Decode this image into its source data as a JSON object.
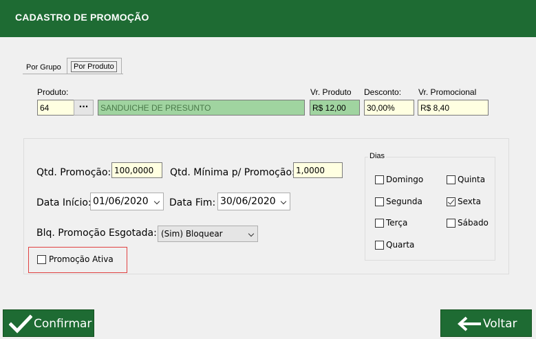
{
  "window": {
    "title": "CADASTRO DE PROMOÇÃO"
  },
  "tabs": [
    {
      "label": "Por Grupo"
    },
    {
      "label": "Por Produto"
    }
  ],
  "produto": {
    "label": "Produto:",
    "code": "64",
    "lookup_label": "···",
    "name": "SANDUICHE DE PRESUNTO",
    "vr_produto_label": "Vr. Produto",
    "vr_produto": "R$ 12,00",
    "desconto_label": "Desconto:",
    "desconto": "30,00%",
    "vr_promocional_label": "Vr. Promocional",
    "vr_promocional": "R$ 8,40"
  },
  "form": {
    "qtd_promocao_label": "Qtd. Promoção:",
    "qtd_promocao": "100,0000",
    "qtd_minima_label": "Qtd. Mínima p/ Promoção:",
    "qtd_minima": "1,0000",
    "data_inicio_label": "Data Início:",
    "data_inicio": "01/06/2020",
    "data_fim_label": "Data Fim:",
    "data_fim": "30/06/2020",
    "blq_label": "Blq. Promoção Esgotada:",
    "blq_value": "(Sim) Bloquear",
    "ativa_label": "Promoção Ativa",
    "ativa_checked": false
  },
  "dias": {
    "label": "Dias",
    "items": [
      {
        "label": "Domingo",
        "checked": false
      },
      {
        "label": "Segunda",
        "checked": false
      },
      {
        "label": "Terça",
        "checked": false
      },
      {
        "label": "Quarta",
        "checked": false
      },
      {
        "label": "Quinta",
        "checked": false
      },
      {
        "label": "Sexta",
        "checked": true
      },
      {
        "label": "Sábado",
        "checked": false
      }
    ]
  },
  "buttons": {
    "confirmar": "Confirmar",
    "voltar": "Voltar"
  },
  "colors": {
    "header": "#1e6b33",
    "field_bg": "#ffffe1",
    "readonly_bg": "#a0d4a0",
    "highlight": "#e04040"
  },
  "icons": {
    "confirm": "checkmark-icon",
    "back": "arrow-left-icon",
    "dropdown": "chevron-down-icon"
  }
}
